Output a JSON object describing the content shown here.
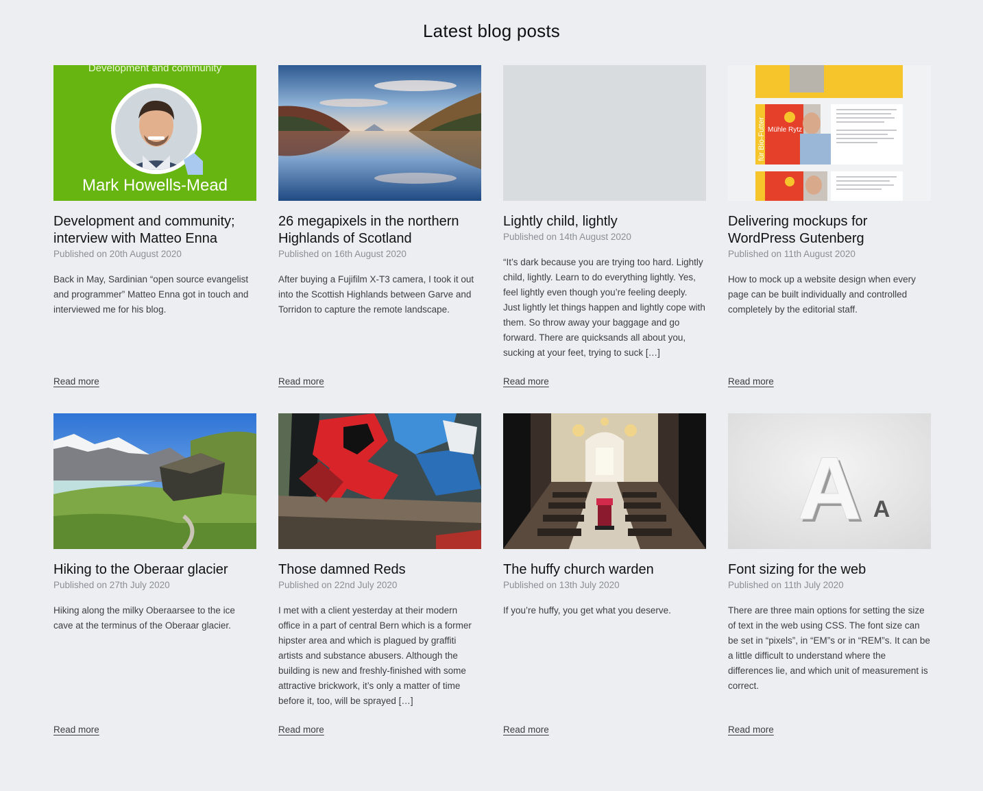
{
  "section": {
    "title": "Latest blog posts"
  },
  "posts": [
    {
      "title": "Development and community; interview with Matteo Enna",
      "date": "Published on 20th August 2020",
      "excerpt": "Back in May, Sardinian “open source evangelist and programmer” Matteo Enna got in touch and interviewed me for his blog.",
      "read_more": "Read more",
      "image": {
        "type": "portrait-card",
        "caption_top": "Development and community",
        "caption_bottom": "Mark Howells-Mead",
        "bg": "#67b510"
      }
    },
    {
      "title": "26 megapixels in the northern Highlands of Scotland",
      "date": "Published on 16th August 2020",
      "excerpt": "After buying a Fujifilm X-T3 camera, I took it out into the Scottish Highlands between Garve and Torridon to capture the remote landscape.",
      "read_more": "Read more",
      "image": {
        "type": "loch-reflection"
      }
    },
    {
      "title": "Lightly child, lightly",
      "date": "Published on 14th August 2020",
      "excerpt": "“It’s dark because you are trying too hard. Lightly child, lightly. Learn to do everything lightly. Yes, feel lightly even though you’re feeling deeply. Just lightly let things happen and lightly cope with them. So throw away your baggage and go forward. There are quicksands all about you, sucking at your feet, trying to suck […]",
      "read_more": "Read more",
      "image": {
        "type": "placeholder",
        "bg": "#d9dcdf"
      }
    },
    {
      "title": "Delivering mockups for WordPress Gutenberg",
      "date": "Published on 11th August 2020",
      "excerpt": "How to mock up a website design when every page can be built individually and controlled completely by the editorial staff.",
      "read_more": "Read more",
      "image": {
        "type": "mockup-screens",
        "brand": "Mühle Rytz AG",
        "side_text": "für Bio-Futter"
      }
    },
    {
      "title": "Hiking to the Oberaar glacier",
      "date": "Published on 27th July 2020",
      "excerpt": "Hiking along the milky Oberaarsee to the ice cave at the terminus of the Oberaar glacier.",
      "read_more": "Read more",
      "image": {
        "type": "alpine-boulder"
      }
    },
    {
      "title": "Those damned Reds",
      "date": "Published on 22nd July 2020",
      "excerpt": "I met with a client yesterday at their modern office in a part of central Bern which is a former hipster area and which is plagued by graffiti artists and substance abusers. Although the building is new and freshly-finished with some attractive brickwork, it’s only a matter of time before it, too, will be sprayed […]",
      "read_more": "Read more",
      "image": {
        "type": "graffiti"
      }
    },
    {
      "title": "The huffy church warden",
      "date": "Published on 13th July 2020",
      "excerpt": "If you’re huffy, you get what you deserve.",
      "read_more": "Read more",
      "image": {
        "type": "church-interior"
      }
    },
    {
      "title": "Font sizing for the web",
      "date": "Published on 11th July 2020",
      "excerpt": "There are three main options for setting the size of text in the web using CSS. The font size can be set in “pixels”, in “EM”s or in “REM”s. It can be a little difficult to understand where the differences lie, and which unit of measurement is correct.",
      "read_more": "Read more",
      "image": {
        "type": "letters",
        "big": "A",
        "small": "A"
      }
    }
  ]
}
